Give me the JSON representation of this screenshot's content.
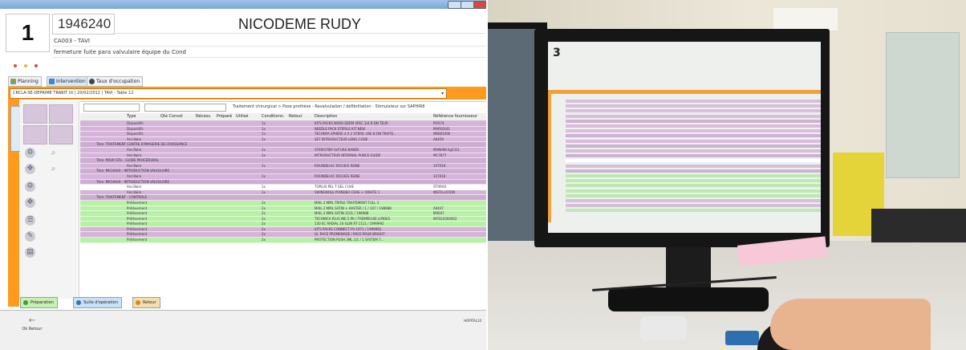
{
  "app": {
    "patient": {
      "bed": "1",
      "id": "1946240",
      "name": "NICODEME RUDY",
      "line1": "CA003 - TAVI",
      "line2": "fermeture fuite para valvulaire équipe du Cond"
    },
    "tabs": [
      {
        "label": "Planning",
        "icon_color": "#7fa35a"
      },
      {
        "label": "Intervention",
        "icon_color": "#3a86d1"
      },
      {
        "label": "Taux d'occupation",
        "icon_color": "#444444"
      }
    ],
    "selector_text": "CRCLA-SE-DEPRIME TRABIT Ut | 20/02/2012 | TAVI - Table 12",
    "filter_text": "Traitement chirurgical > Pose prothèse - Revalvulation / défibrillation - Stimulateur sur SAPHIR8",
    "columns": [
      "Type",
      "Qté Convol",
      "Nécess.",
      "Préparé",
      "Utilisé",
      "Conditionn.",
      "Retour",
      "Description",
      "Référence fournisseur"
    ],
    "rows": [
      {
        "color": "purple",
        "type": "Dispositifs",
        "qty": "1x",
        "desc": "KITS PACKS NORD DERM SPEC 3/4 B DN TEUR",
        "ref": "PIF074"
      },
      {
        "color": "purple",
        "type": "Dispositifs",
        "qty": "1x",
        "desc": "NEEDLE PACK STERILE KIT NEW",
        "ref": "MARGIS41"
      },
      {
        "color": "purple",
        "type": "Dispositifs",
        "qty": "1x",
        "desc": "TECHNYA SPHERE 4 X 2 STERIL USE B DN TRAITE...",
        "ref": "MEB01000"
      },
      {
        "color": "purple",
        "type": "Ancillaire",
        "qty": "1x",
        "desc": "SET INTRODUCTEUR LONG CODE",
        "ref": "A6459"
      },
      {
        "color": "purpleg",
        "type": "Titre: TRAITEMENT CENTRE D'IMAGERIE DE CROISSANCE",
        "qty": "",
        "desc": "",
        "ref": ""
      },
      {
        "color": "purple",
        "type": "Ancillaire",
        "qty": "1x",
        "desc": "STERISTRIP SUTURE BANDE",
        "ref": "MAN098 Ilg2311"
      },
      {
        "color": "purple",
        "type": "Ancillaire",
        "qty": "1x",
        "desc": "INTRODUCTEUR INTERNAL PUNCE GUIDE",
        "ref": "MC7877"
      },
      {
        "color": "purpleg",
        "type": "Titre: POUR STIL - GUIDE PROCÉDURAL",
        "qty": "",
        "desc": "",
        "ref": ""
      },
      {
        "color": "purple",
        "type": "Ancillaire",
        "qty": "1x",
        "desc": "ROUNDELAC ROCHES REINE",
        "ref": "107018"
      },
      {
        "color": "purpleg",
        "type": "Titre: MICHAUX - INTRODUCTION VALVULAIRE",
        "qty": "",
        "desc": "",
        "ref": ""
      },
      {
        "color": "purple",
        "type": "Ancillaire",
        "qty": "1x",
        "desc": "ROUNDELAC ROCHES REINE",
        "ref": "107018"
      },
      {
        "color": "purpleg",
        "type": "Titre: MICHAUX - INTRODUCTION VALVULAIRE",
        "qty": "",
        "desc": "",
        "ref": ""
      },
      {
        "color": "white",
        "type": "Ancillaire",
        "qty": "1x",
        "desc": "TOPLUS PEL T GEL CUVE",
        "ref": "STORA0"
      },
      {
        "color": "purple",
        "type": "Ancillaire",
        "qty": "1x",
        "desc": "SWINGNOLE POINDER CORE + ORHITE 1",
        "ref": "INSTILLATION"
      },
      {
        "color": "purpleg",
        "type": "Titre: TRAITEMENT - CONTROLE",
        "qty": "",
        "desc": "",
        "ref": ""
      },
      {
        "color": "green",
        "type": "Prélèvement",
        "qty": "2x",
        "desc": "MAIL 2 MML TRIPLE TRAITEMENT FULL 3",
        "ref": ""
      },
      {
        "color": "green",
        "type": "Prélèvement",
        "qty": "2x",
        "desc": "MAIL 2 MML SATIN + HASTER / 1 / 107 / 198988",
        "ref": "A9447"
      },
      {
        "color": "green",
        "type": "Prélèvement",
        "qty": "2x",
        "desc": "MAIL 2 MML SATIN 1101 / 198988",
        "ref": "M9047"
      },
      {
        "color": "green",
        "type": "Prélèvement",
        "qty": "2x",
        "desc": "TECHNICA PLUS INE 5 PK / TREMPEUSE LIPIDES",
        "ref": "INT024300002"
      },
      {
        "color": "green",
        "type": "Prélèvement",
        "qty": "2x",
        "desc": "130 EC RADIAL 16 GLIN RT 1111 / 1999992",
        "ref": ""
      },
      {
        "color": "purple",
        "type": "Prélèvement",
        "qty": "2x",
        "desc": "KITS PACKS CONNECT PV 1971 / 1999992",
        "ref": ""
      },
      {
        "color": "purple",
        "type": "Prélèvement",
        "qty": "2x",
        "desc": "GL RACE PROMENADE / RACE POUR BRIGHT",
        "ref": ""
      },
      {
        "color": "green",
        "type": "Prélèvement",
        "qty": "2x",
        "desc": "PROTECTION PUSH 3ML 1/1 / 1 SYSTEM 7...",
        "ref": ""
      }
    ],
    "bottom_tabs": [
      {
        "label": "Préparation",
        "color": "#c7f0b3",
        "icon": "#4a9a3a"
      },
      {
        "label": "Suite d'opération",
        "color": "#c9e0f6",
        "icon": "#3a6fb0"
      },
      {
        "label": "Retour",
        "color": "#f6ddb0",
        "icon": "#d28b1a"
      }
    ],
    "back_label": "Ok Retour",
    "version": "HOPITAL10"
  },
  "photo": {
    "screen_bed": "3"
  }
}
